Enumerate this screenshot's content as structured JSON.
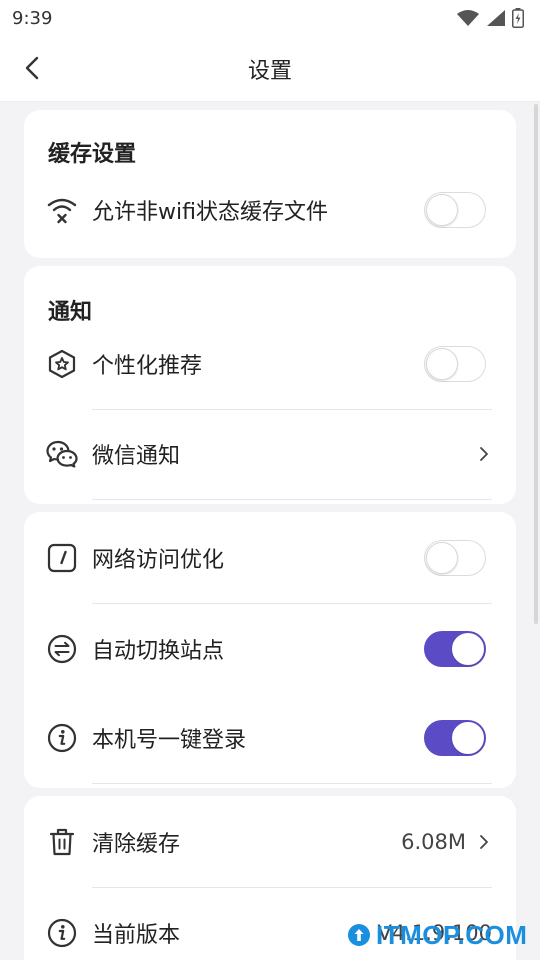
{
  "status_bar": {
    "time": "9:39"
  },
  "nav": {
    "title": "设置"
  },
  "cache_section": {
    "title": "缓存设置",
    "rows": [
      {
        "label": "允许非wifi状态缓存文件",
        "toggle_on": false
      }
    ]
  },
  "notify_section": {
    "title": "通知",
    "rows": [
      {
        "label": "个性化推荐",
        "toggle_on": false
      },
      {
        "label": "微信通知"
      }
    ]
  },
  "network_section": {
    "rows": [
      {
        "label": "网络访问优化",
        "toggle_on": false
      },
      {
        "label": "自动切换站点",
        "toggle_on": true
      },
      {
        "label": "本机号一键登录",
        "toggle_on": true
      }
    ]
  },
  "misc_section": {
    "rows": [
      {
        "label": "清除缓存",
        "value": "6.08M"
      },
      {
        "label": "当前版本",
        "value": "V4.1.9.100"
      }
    ]
  },
  "watermark": {
    "text": "ITMOP.COM"
  },
  "colors": {
    "accent": "#5b4bc4",
    "watermark": "#1a8fe0"
  }
}
